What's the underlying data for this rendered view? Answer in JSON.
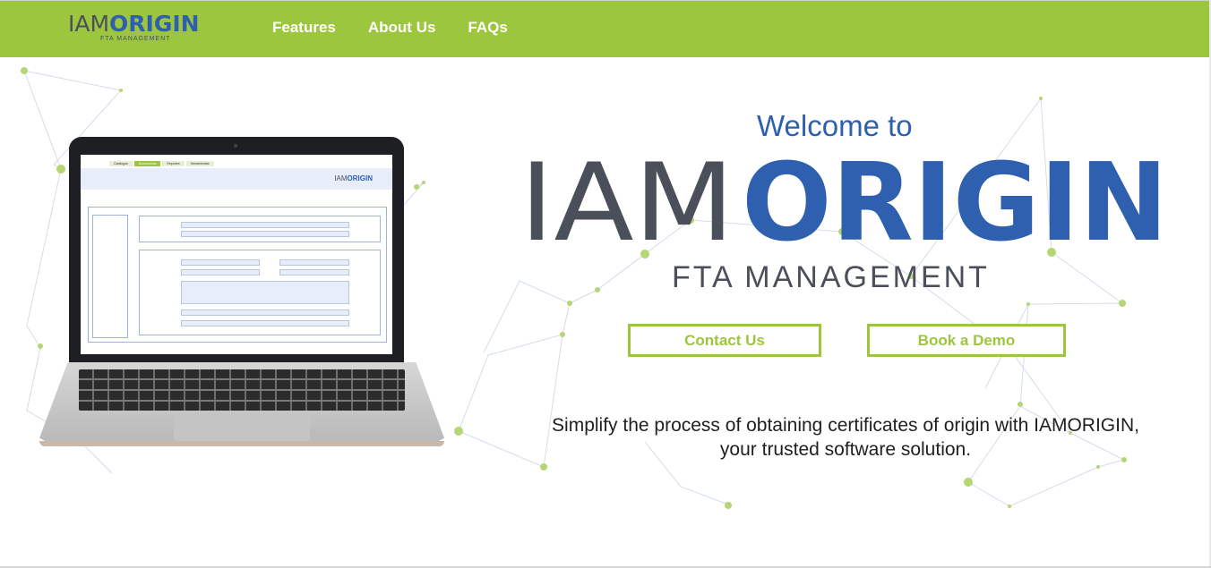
{
  "header": {
    "logo_iam": "IAM",
    "logo_origin": "ORIGIN",
    "logo_sub": "FTA MANAGEMENT",
    "nav": [
      "Features",
      "About Us",
      "FAQs"
    ]
  },
  "hero": {
    "welcome": "Welcome to",
    "logo_iam": "IAM",
    "logo_origin": "ORIGIN",
    "fta": "FTA MANAGEMENT",
    "contact_label": "Contact Us",
    "demo_label": "Book a Demo",
    "tagline": "Simplify the process of obtaining certificates of origin with IAMORIGIN, your trusted software solution."
  },
  "laptop_screen": {
    "tabs": [
      "Catálogos",
      "Documentos",
      "Reportes",
      "Herramientas"
    ],
    "logo_iam": "IAM",
    "logo_origin": "ORIGIN"
  },
  "colors": {
    "brand_green": "#9dc63f",
    "brand_blue": "#2f60b0",
    "logo_gray": "#4a4f5a"
  }
}
